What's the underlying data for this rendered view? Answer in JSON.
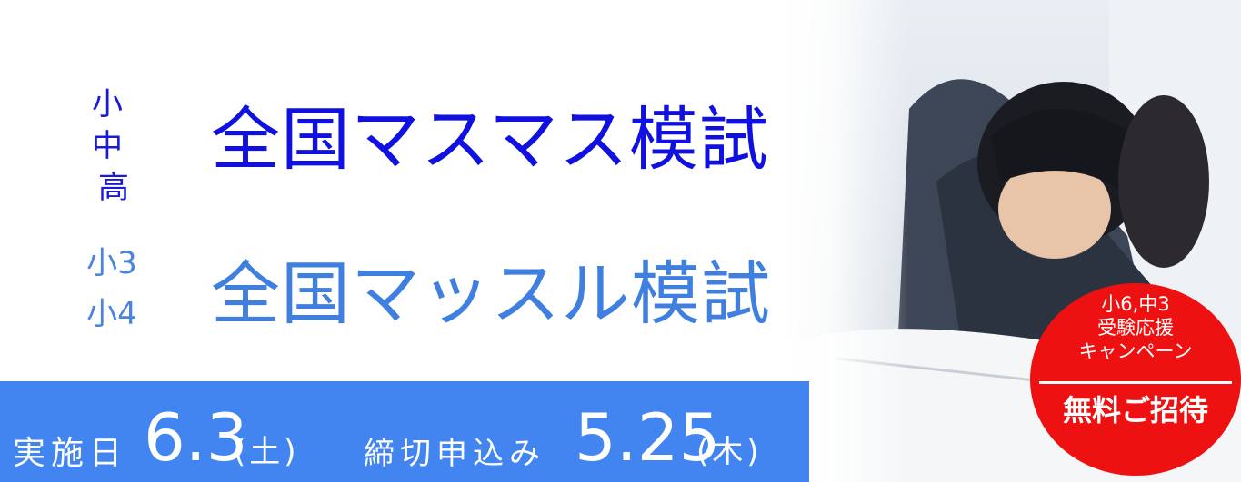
{
  "grade_mas": {
    "line1": "小 中",
    "line2": "高"
  },
  "title_mas": "全国マスマス模試",
  "grade_muscle": {
    "line1": "小3",
    "line2": "小4"
  },
  "title_muscle": "全国マッスル模試",
  "band": {
    "date_label": "実施日",
    "date_value": "6.3",
    "date_day": "(土)",
    "deadline_label": "締切申込み",
    "deadline_value": "5.25",
    "deadline_day": "(木)"
  },
  "badge": {
    "line1": "小6,中3",
    "line2": "受験応援",
    "line3": "キャンペーン",
    "main": "無料ご招待"
  },
  "colors": {
    "title_mas": "#1010e0",
    "title_muscle": "#3f7fe0",
    "band": "#4285f0",
    "badge": "#ee1111"
  }
}
